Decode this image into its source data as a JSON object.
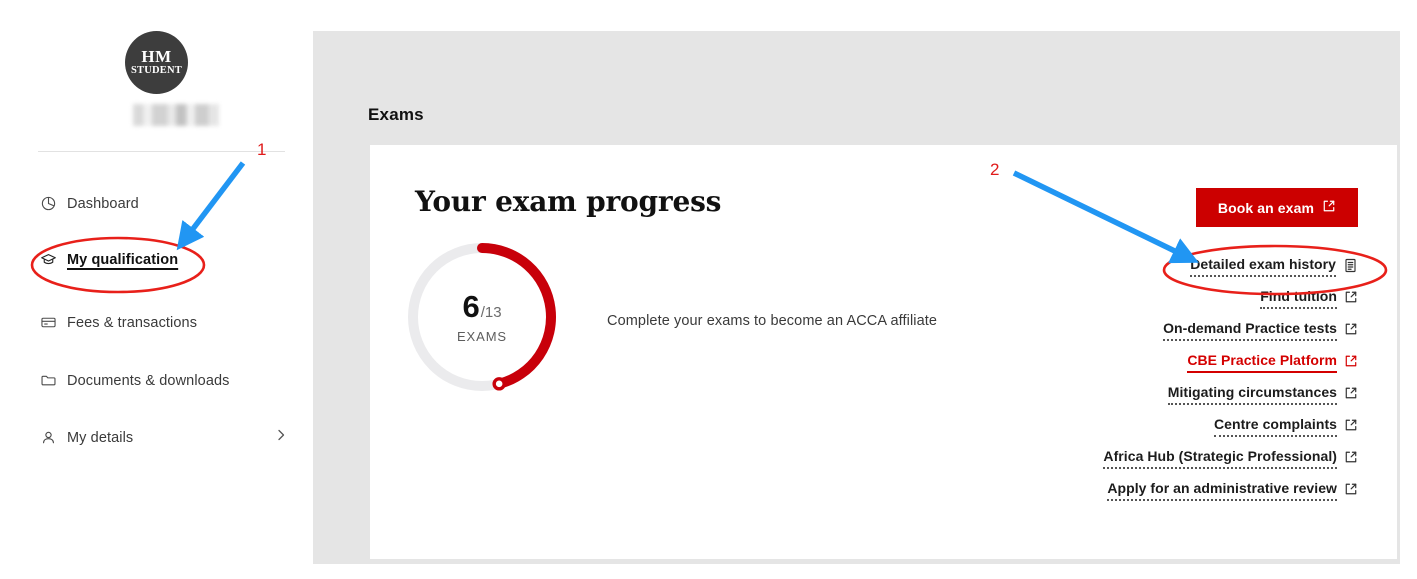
{
  "sidebar": {
    "avatar": {
      "initials": "HM",
      "role": "STUDENT",
      "name_redacted": ""
    },
    "items": [
      {
        "label": "Dashboard",
        "icon": "pie-chart-icon"
      },
      {
        "label": "My qualification",
        "icon": "graduation-cap-icon"
      },
      {
        "label": "Fees & transactions",
        "icon": "credit-card-icon"
      },
      {
        "label": "Documents & downloads",
        "icon": "folder-icon"
      },
      {
        "label": "My details",
        "icon": "person-icon"
      }
    ]
  },
  "main": {
    "page_title": "Exams",
    "card": {
      "heading": "Your exam progress",
      "caption": "Complete your exams to become an ACCA affiliate"
    }
  },
  "progress": {
    "current": "6",
    "total": "/13",
    "unit": "EXAMS",
    "percent": 46,
    "ring_color": "#c8000a",
    "track_color": "#ebebed"
  },
  "actions": {
    "primary_button": {
      "label": "Book an exam",
      "icon": "external-link-icon",
      "color": "#cc0000"
    },
    "links": [
      {
        "label": "Detailed exam history",
        "icon": "document-list-icon",
        "active": false
      },
      {
        "label": "Find tuition",
        "icon": "external-link-icon",
        "active": false
      },
      {
        "label": "On-demand Practice tests",
        "icon": "external-link-icon",
        "active": false
      },
      {
        "label": "CBE Practice Platform",
        "icon": "external-link-icon",
        "active": true
      },
      {
        "label": "Mitigating circumstances",
        "icon": "external-link-icon",
        "active": false
      },
      {
        "label": "Centre complaints",
        "icon": "external-link-icon",
        "active": false
      },
      {
        "label": "Africa Hub (Strategic Professional)",
        "icon": "external-link-icon",
        "active": false
      },
      {
        "label": "Apply for an administrative review",
        "icon": "external-link-icon",
        "active": false
      }
    ]
  },
  "annotations": {
    "marker_color": "#e01b1b",
    "arrow_color": "#2196f3",
    "items": [
      {
        "number": "1",
        "target": "My qualification"
      },
      {
        "number": "2",
        "target": "Detailed exam history"
      }
    ]
  }
}
